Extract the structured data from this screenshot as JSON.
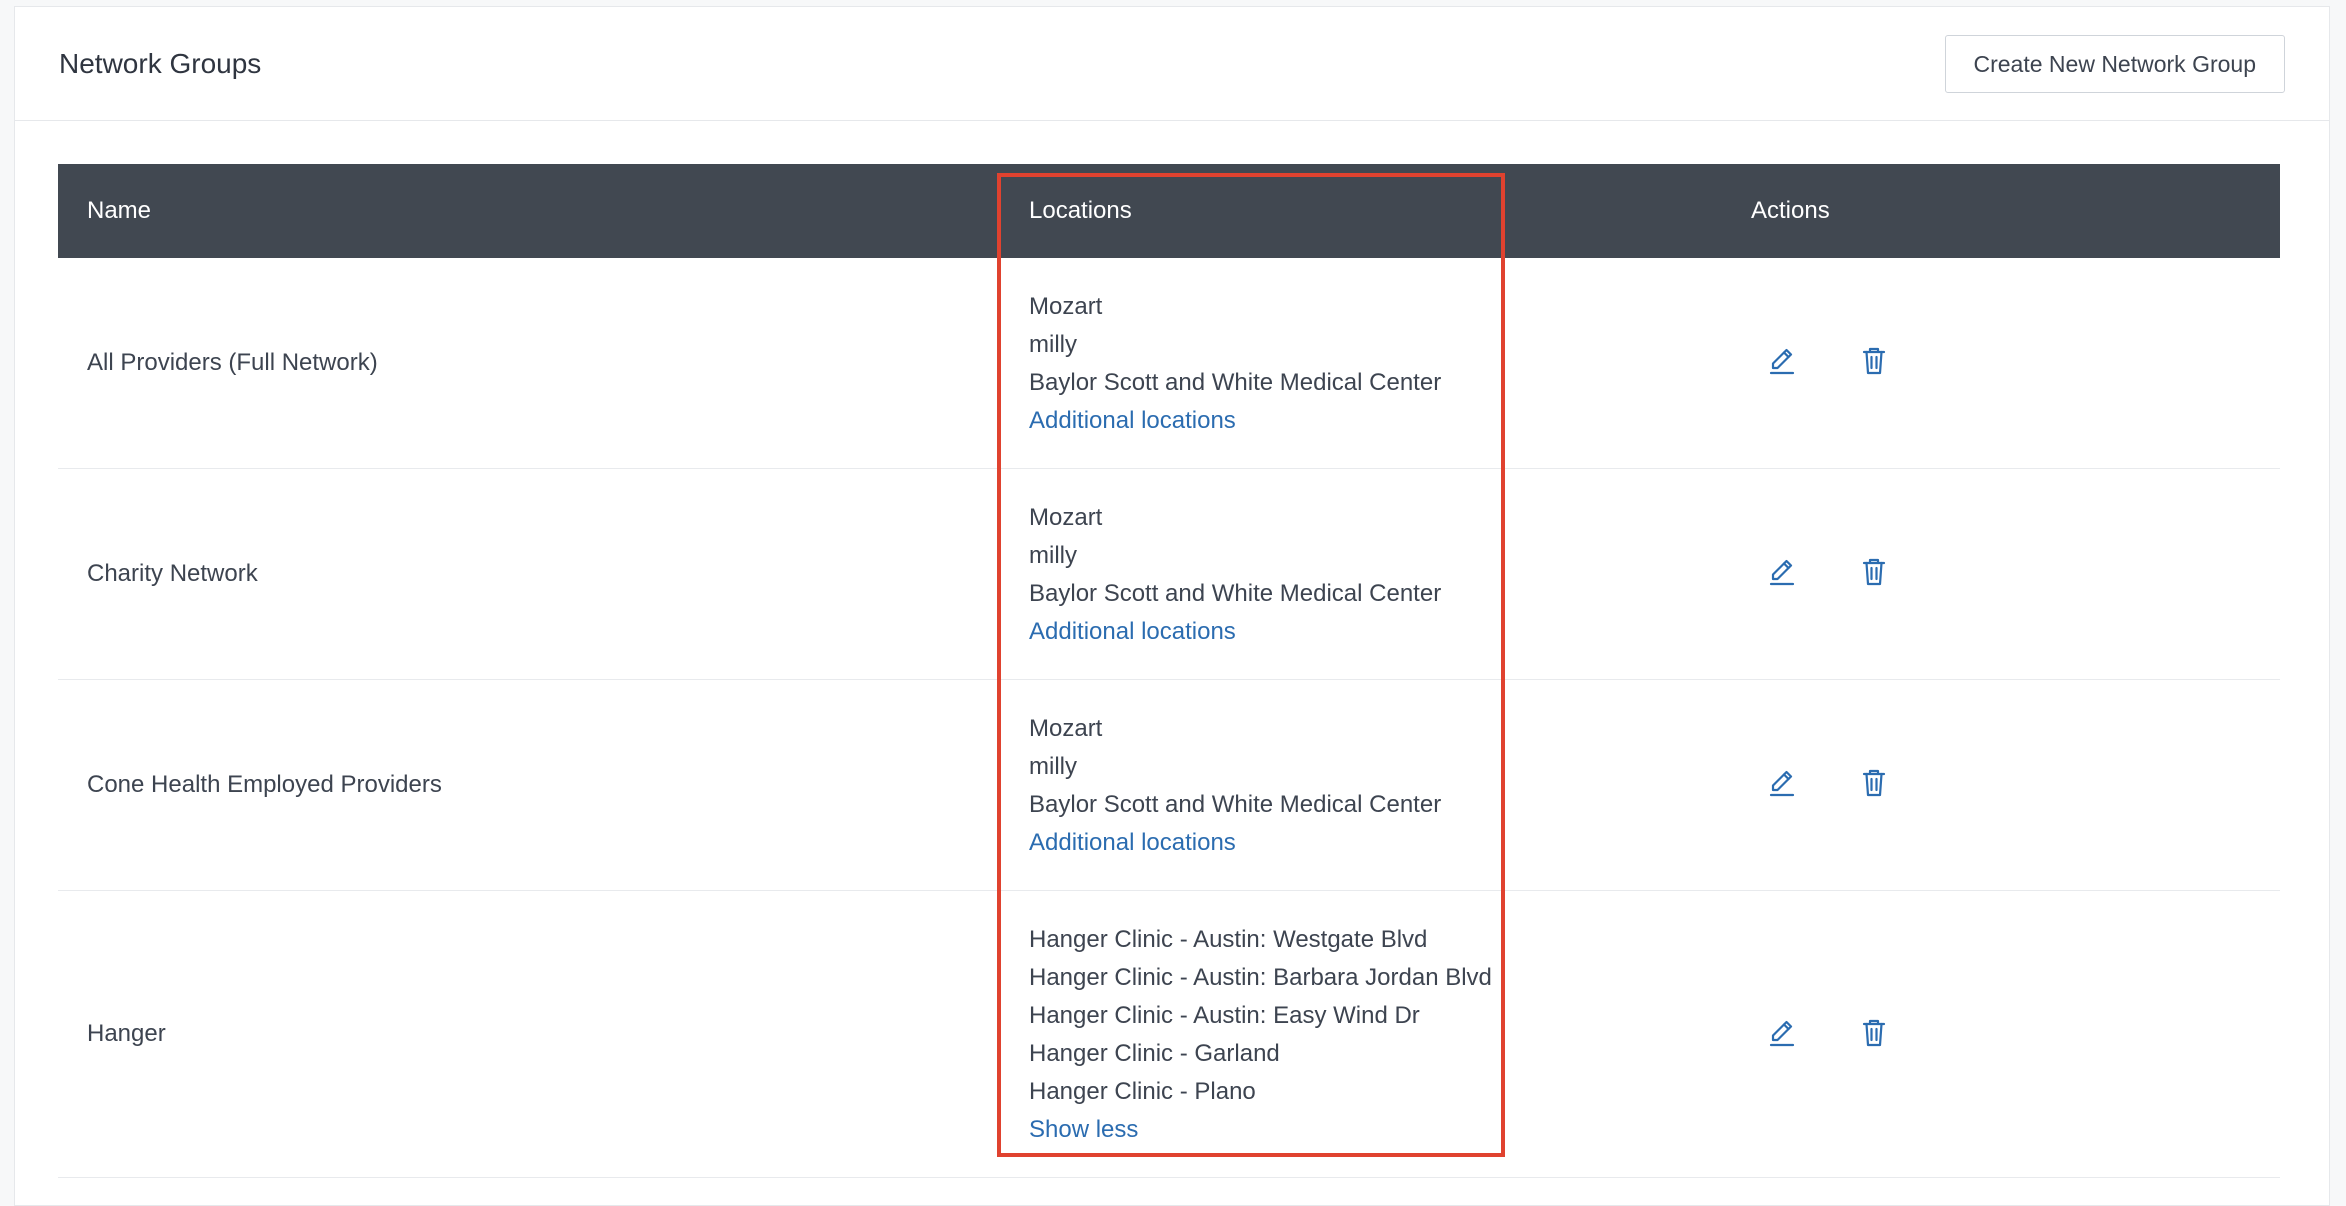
{
  "header": {
    "title": "Network Groups",
    "create_button": "Create New Network Group"
  },
  "table": {
    "columns": {
      "name": "Name",
      "locations": "Locations",
      "actions": "Actions"
    },
    "rows": [
      {
        "name": "All Providers (Full Network)",
        "locations": [
          "Mozart",
          "milly",
          "Baylor Scott and White Medical Center"
        ],
        "link": "Additional locations"
      },
      {
        "name": "Charity Network",
        "locations": [
          "Mozart",
          "milly",
          "Baylor Scott and White Medical Center"
        ],
        "link": "Additional locations"
      },
      {
        "name": "Cone Health Employed Providers",
        "locations": [
          "Mozart",
          "milly",
          "Baylor Scott and White Medical Center"
        ],
        "link": "Additional locations"
      },
      {
        "name": "Hanger",
        "locations": [
          "Hanger Clinic - Austin: Westgate Blvd",
          "Hanger Clinic - Austin: Barbara Jordan Blvd",
          "Hanger Clinic - Austin: Easy Wind Dr",
          "Hanger Clinic - Garland",
          "Hanger Clinic - Plano"
        ],
        "link": "Show less"
      }
    ]
  },
  "icons": {
    "edit": "pencil-edit-icon",
    "delete": "trash-icon"
  },
  "colors": {
    "header_bg": "#414851",
    "link": "#2b6cb0",
    "highlight": "#e0422f"
  }
}
